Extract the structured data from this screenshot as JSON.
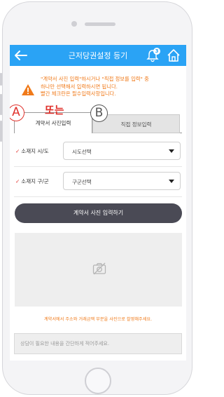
{
  "header": {
    "title": "근저당권설정 등기",
    "notification_count": "3"
  },
  "notice": {
    "lines": [
      "\"계약서 사진 입력\"하시거나 \"직접 정보를 입력\" 중",
      "하나만 선택해서 입력하시면 됩니다.",
      "빨간 체크란은 필수입력사항입니다."
    ]
  },
  "annotations": {
    "a": "A",
    "b": "B",
    "or": "또는"
  },
  "tabs": [
    {
      "label": "계약서 사진입력",
      "active": true
    },
    {
      "label": "직접 정보입력",
      "active": false
    }
  ],
  "form": {
    "rows": [
      {
        "check": "✓",
        "label": "소재지 시/도",
        "value": "시도선택"
      },
      {
        "check": "✓",
        "label": "소재지 구/군",
        "value": "구군선택"
      }
    ],
    "photo_button": "계약서 사진 입력하기",
    "photo_hint": "계약서에서 주소와 거래금액 부분을 사진으로 촬영해주세요.",
    "memo_placeholder": "상담이 필요한 내용을 간단하게 적어주세요."
  },
  "colors": {
    "header": "#2aa3f5",
    "warning": "#f07a1a",
    "annotation_a": "#e0312b",
    "button": "#4a4a55"
  },
  "icons": [
    "back-arrow-icon",
    "bell-icon",
    "home-icon",
    "warning-icon",
    "camera-icon",
    "chevron-down-icon"
  ]
}
